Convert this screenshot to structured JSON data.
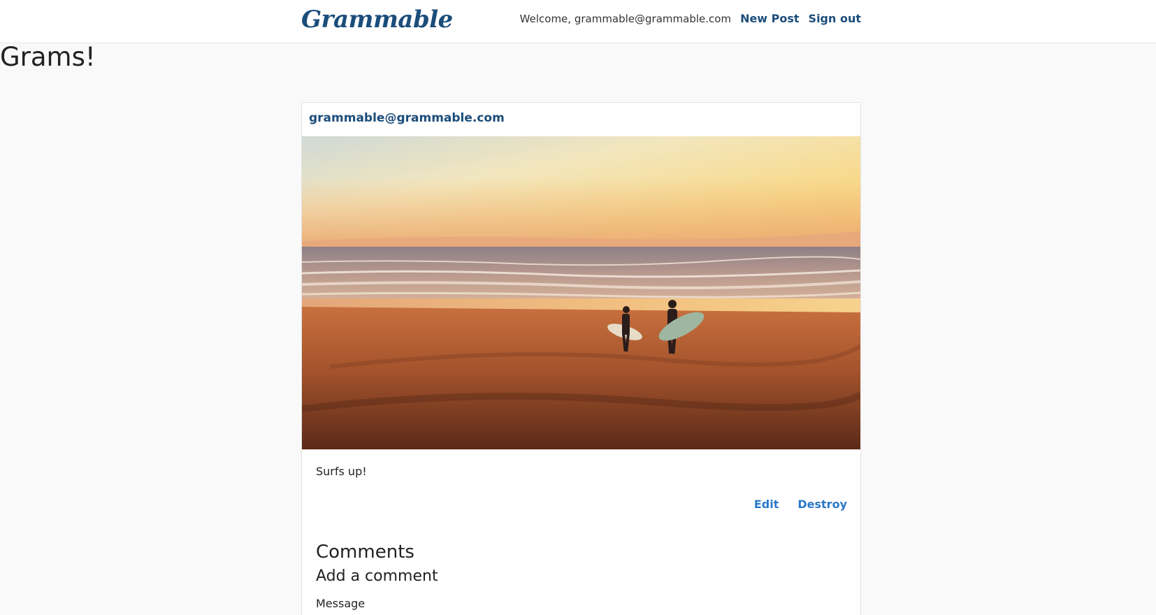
{
  "nav": {
    "brand": "Grammable",
    "welcome": "Welcome, grammable@grammable.com",
    "new_post": "New Post",
    "sign_out": "Sign out"
  },
  "page": {
    "title": "Grams!"
  },
  "gram": {
    "user": "grammable@grammable.com",
    "caption": "Surfs up!",
    "edit_label": "Edit",
    "destroy_label": "Destroy"
  },
  "comments": {
    "heading": "Comments",
    "add_heading": "Add a comment",
    "message_label": "Message"
  },
  "colors": {
    "brand": "#1b4d7a",
    "action_link": "#2a78c8",
    "background": "#f9f9f9"
  }
}
